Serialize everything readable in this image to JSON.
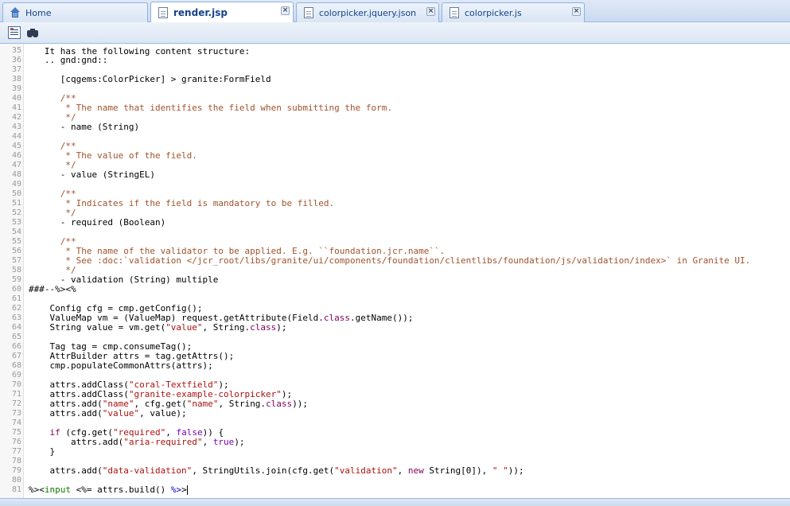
{
  "tabs": [
    {
      "label": "Home",
      "icon": "home-icon",
      "active": false
    },
    {
      "label": "render.jsp",
      "icon": "document-icon",
      "active": true
    },
    {
      "label": "colorpicker.jquery.json",
      "icon": "document-icon",
      "active": false
    },
    {
      "label": "colorpicker.js",
      "icon": "document-icon",
      "active": false
    }
  ],
  "toolbar": {
    "buttons": [
      {
        "icon": "format-code-icon"
      },
      {
        "icon": "binoculars-search-icon"
      }
    ]
  },
  "editor": {
    "partial_top_line": "   It has the following content structure:",
    "lines": [
      {
        "n": "35",
        "segs": []
      },
      {
        "n": "36",
        "segs": [
          {
            "t": "   .. gnd:gnd::",
            "c": ""
          }
        ]
      },
      {
        "n": "37",
        "segs": []
      },
      {
        "n": "38",
        "segs": [
          {
            "t": "      [cqgems:ColorPicker] > granite:FormField",
            "c": ""
          }
        ]
      },
      {
        "n": "39",
        "segs": []
      },
      {
        "n": "40",
        "segs": [
          {
            "t": "      /**",
            "c": "c-comment"
          }
        ]
      },
      {
        "n": "41",
        "segs": [
          {
            "t": "       * The name that identifies the field when submitting the form.",
            "c": "c-comment"
          }
        ]
      },
      {
        "n": "42",
        "segs": [
          {
            "t": "       */",
            "c": "c-comment"
          }
        ]
      },
      {
        "n": "43",
        "segs": [
          {
            "t": "      - name (String)",
            "c": ""
          }
        ]
      },
      {
        "n": "44",
        "segs": []
      },
      {
        "n": "45",
        "segs": [
          {
            "t": "      /**",
            "c": "c-comment"
          }
        ]
      },
      {
        "n": "46",
        "segs": [
          {
            "t": "       * The value of the field.",
            "c": "c-comment"
          }
        ]
      },
      {
        "n": "47",
        "segs": [
          {
            "t": "       */",
            "c": "c-comment"
          }
        ]
      },
      {
        "n": "48",
        "segs": [
          {
            "t": "      - value (StringEL)",
            "c": ""
          }
        ]
      },
      {
        "n": "49",
        "segs": []
      },
      {
        "n": "50",
        "segs": [
          {
            "t": "      /**",
            "c": "c-comment"
          }
        ]
      },
      {
        "n": "51",
        "segs": [
          {
            "t": "       * Indicates if the field is mandatory to be filled.",
            "c": "c-comment"
          }
        ]
      },
      {
        "n": "52",
        "segs": [
          {
            "t": "       */",
            "c": "c-comment"
          }
        ]
      },
      {
        "n": "53",
        "segs": [
          {
            "t": "      - required (Boolean)",
            "c": ""
          }
        ]
      },
      {
        "n": "54",
        "segs": []
      },
      {
        "n": "55",
        "segs": [
          {
            "t": "      /**",
            "c": "c-comment"
          }
        ]
      },
      {
        "n": "56",
        "segs": [
          {
            "t": "       * The name of the validator to be applied. E.g. ``foundation.jcr.name``.",
            "c": "c-comment"
          }
        ]
      },
      {
        "n": "57",
        "segs": [
          {
            "t": "       * See :doc:`validation </jcr_root/libs/granite/ui/components/foundation/clientlibs/foundation/js/validation/index>` in Granite UI.",
            "c": "c-comment"
          }
        ]
      },
      {
        "n": "58",
        "segs": [
          {
            "t": "       */",
            "c": "c-comment"
          }
        ]
      },
      {
        "n": "59",
        "segs": [
          {
            "t": "      - validation (String) multiple",
            "c": ""
          }
        ]
      },
      {
        "n": "60",
        "segs": [
          {
            "t": "###--%><%",
            "c": ""
          }
        ]
      },
      {
        "n": "61",
        "segs": []
      },
      {
        "n": "62",
        "segs": [
          {
            "t": "    Config cfg = cmp.getConfig();",
            "c": ""
          }
        ]
      },
      {
        "n": "63",
        "segs": [
          {
            "t": "    ValueMap vm = (ValueMap) request.getAttribute(Field.",
            "c": ""
          },
          {
            "t": "class",
            "c": "c-kw"
          },
          {
            "t": ".getName());",
            "c": ""
          }
        ]
      },
      {
        "n": "64",
        "segs": [
          {
            "t": "    String value = vm.get(",
            "c": ""
          },
          {
            "t": "\"value\"",
            "c": "c-string"
          },
          {
            "t": ", String.",
            "c": ""
          },
          {
            "t": "class",
            "c": "c-kw"
          },
          {
            "t": ");",
            "c": ""
          }
        ]
      },
      {
        "n": "65",
        "segs": []
      },
      {
        "n": "66",
        "segs": [
          {
            "t": "    Tag tag = cmp.consumeTag();",
            "c": ""
          }
        ]
      },
      {
        "n": "67",
        "segs": [
          {
            "t": "    AttrBuilder attrs = tag.getAttrs();",
            "c": ""
          }
        ]
      },
      {
        "n": "68",
        "segs": [
          {
            "t": "    cmp.populateCommonAttrs(attrs);",
            "c": ""
          }
        ]
      },
      {
        "n": "69",
        "segs": []
      },
      {
        "n": "70",
        "segs": [
          {
            "t": "    attrs.addClass(",
            "c": ""
          },
          {
            "t": "\"coral-Textfield\"",
            "c": "c-string"
          },
          {
            "t": ");",
            "c": ""
          }
        ]
      },
      {
        "n": "71",
        "segs": [
          {
            "t": "    attrs.addClass(",
            "c": ""
          },
          {
            "t": "\"granite-example-colorpicker\"",
            "c": "c-string"
          },
          {
            "t": ");",
            "c": ""
          }
        ]
      },
      {
        "n": "72",
        "segs": [
          {
            "t": "    attrs.add(",
            "c": ""
          },
          {
            "t": "\"name\"",
            "c": "c-string"
          },
          {
            "t": ", cfg.get(",
            "c": ""
          },
          {
            "t": "\"name\"",
            "c": "c-string"
          },
          {
            "t": ", String.",
            "c": ""
          },
          {
            "t": "class",
            "c": "c-kw"
          },
          {
            "t": "));",
            "c": ""
          }
        ]
      },
      {
        "n": "73",
        "segs": [
          {
            "t": "    attrs.add(",
            "c": ""
          },
          {
            "t": "\"value\"",
            "c": "c-string"
          },
          {
            "t": ", value);",
            "c": ""
          }
        ]
      },
      {
        "n": "74",
        "segs": []
      },
      {
        "n": "75",
        "segs": [
          {
            "t": "    ",
            "c": ""
          },
          {
            "t": "if",
            "c": "c-kw"
          },
          {
            "t": " (cfg.get(",
            "c": ""
          },
          {
            "t": "\"required\"",
            "c": "c-string"
          },
          {
            "t": ", ",
            "c": ""
          },
          {
            "t": "false",
            "c": "c-purple"
          },
          {
            "t": ")) {",
            "c": ""
          }
        ]
      },
      {
        "n": "76",
        "segs": [
          {
            "t": "        attrs.add(",
            "c": ""
          },
          {
            "t": "\"aria-required\"",
            "c": "c-string"
          },
          {
            "t": ", ",
            "c": ""
          },
          {
            "t": "true",
            "c": "c-purple"
          },
          {
            "t": ");",
            "c": ""
          }
        ]
      },
      {
        "n": "77",
        "segs": [
          {
            "t": "    }",
            "c": ""
          }
        ]
      },
      {
        "n": "78",
        "segs": []
      },
      {
        "n": "79",
        "segs": [
          {
            "t": "    attrs.add(",
            "c": ""
          },
          {
            "t": "\"data-validation\"",
            "c": "c-string"
          },
          {
            "t": ", StringUtils.join(cfg.get(",
            "c": ""
          },
          {
            "t": "\"validation\"",
            "c": "c-string"
          },
          {
            "t": ", ",
            "c": ""
          },
          {
            "t": "new",
            "c": "c-kw"
          },
          {
            "t": " String[0]), ",
            "c": ""
          },
          {
            "t": "\" \"",
            "c": "c-string"
          },
          {
            "t": "));",
            "c": ""
          }
        ]
      },
      {
        "n": "80",
        "segs": []
      },
      {
        "n": "81",
        "segs": [
          {
            "t": "%><",
            "c": ""
          },
          {
            "t": "input",
            "c": "c-tag"
          },
          {
            "t": " <%= attrs.build() ",
            "c": ""
          },
          {
            "t": "%>",
            "c": "c-blue"
          },
          {
            "t": ">",
            "c": ""
          }
        ]
      }
    ]
  }
}
